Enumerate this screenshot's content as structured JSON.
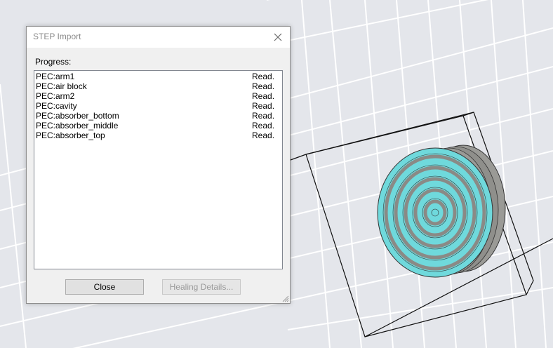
{
  "dialog": {
    "title": "STEP Import",
    "progress_label": "Progress:",
    "items": [
      {
        "name": "PEC:arm1",
        "status": "Read."
      },
      {
        "name": "PEC:air block",
        "status": "Read."
      },
      {
        "name": "PEC:arm2",
        "status": "Read."
      },
      {
        "name": "PEC:cavity",
        "status": "Read."
      },
      {
        "name": "PEC:absorber_bottom",
        "status": "Read."
      },
      {
        "name": "PEC:absorber_middle",
        "status": "Read."
      },
      {
        "name": "PEC:absorber_top",
        "status": "Read."
      }
    ],
    "close_label": "Close",
    "healing_label": "Healing Details..."
  },
  "colors": {
    "background": "#e4e6eb",
    "grid": "#ffffff",
    "model_cyan": "#6fd9dc",
    "model_gray": "#9a9a96"
  },
  "icons": [
    "close-icon",
    "resize-grip-icon"
  ]
}
